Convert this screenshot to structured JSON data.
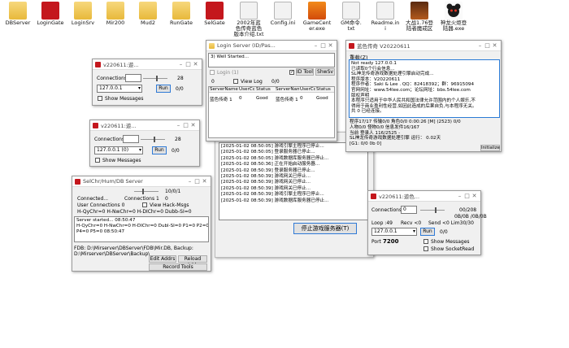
{
  "desktop": {
    "icons": [
      {
        "label": "DBServer",
        "type": "folder"
      },
      {
        "label": "LoginGate",
        "type": "exe-red"
      },
      {
        "label": "LoginSrv",
        "type": "folder"
      },
      {
        "label": "Mir200",
        "type": "folder"
      },
      {
        "label": "Mud2",
        "type": "folder"
      },
      {
        "label": "RunGate",
        "type": "folder"
      },
      {
        "label": "SelGate",
        "type": "exe-red"
      },
      {
        "label": "2002年蓝\n色传奇蓝色\n版本介绍.txt",
        "type": "doc"
      },
      {
        "label": "Config.ini",
        "type": "doc"
      },
      {
        "label": "GameCent\ner.exe",
        "type": "exe-orange"
      },
      {
        "label": "GM命令.\ntxt",
        "type": "doc"
      },
      {
        "label": "Readme.in\ni",
        "type": "doc"
      },
      {
        "label": "大战1.76登\n陆者魔戒区",
        "type": "game"
      },
      {
        "label": "神龙火炬登\n陆器.exe",
        "type": "bear"
      }
    ]
  },
  "login_gate": {
    "title": "v220611:遊...",
    "connections_label": "Connections",
    "count": "28",
    "ip": "127.0.0.1",
    "ratio": "0/0",
    "run_label": "Run",
    "show_messages_label": "Show Messages"
  },
  "sel_gate": {
    "title": "v220611:遊...",
    "connections_label": "Connections",
    "count": "28",
    "ip": "127.0.0.1 (0)",
    "ratio": "0/0",
    "run_label": "Run",
    "show_messages_label": "Show Messages"
  },
  "login_server": {
    "title": "Login Server (ID/Pas...",
    "status_line": "3) Well Started...",
    "login_label": "Login (1)",
    "login_count": "0",
    "view_log_label": "View Log",
    "view_log_value": "0/0",
    "id_tool_label": "ID Tool",
    "show_sv_label": "ShwSv",
    "columns": [
      "ServerName",
      "UserCc",
      "Status",
      "ServerName",
      "UserCc",
      "Status"
    ],
    "rows": [
      [
        "蓝色传奇 1",
        "0",
        "Good",
        "蓝色传奇 1",
        "0",
        "Good"
      ]
    ]
  },
  "game_center": {
    "log_lines": [
      "[2025-01-02 08:50:05] 游戏引擎主程序已停止...",
      "[2025-01-02 08:50:05] 登录服务器已停止...",
      "[2025-01-02 08:50:05] 游戏数据库服务器已停止...",
      "[2025-01-02 08:50:36] 正在开始启动服务器...",
      "[2025-01-02 08:50:39] 登录服务器已停止...",
      "[2025-01-02 08:50:39] 游戏网关已停止...",
      "[2025-01-02 08:50:39] 游戏网关已停止...",
      "[2025-01-02 08:50:39] 游戏网关已停止...",
      "[2025-01-02 08:50:39] 游戏引擎主程序已停止...",
      "[2025-01-02 08:50:39] 游戏数据库服务器已停止..."
    ],
    "stop_button_label": "停止游戏服务器(T)"
  },
  "m2_server": {
    "title": "蓝色传奇   V20220611",
    "menu_label": "重载(Z)",
    "messages": [
      "Not ready 127.0.0.1",
      "已读取0个行会信息...",
      "SL神龙传奇游戏数据处理引擎启动完成...",
      "程序版本：V20220611",
      "程序作者：Saki & Lee . QQ：82418392；群：96915094",
      "官网网址：www.54lee.com；论坛网址：bbs.54lee.com",
      "版权声明",
      "本程序只适用于中华人民共和国法律允许范围内的个人娱乐,不",
      "得用于商业盈利性经营,如因此造成的后果自负,与本程序无关。",
      "共 0 已经连接。"
    ],
    "stat_lines": [
      "程序17/17 传输0/0 角色0/0   0:00:26 [M]   (2523)  0/0",
      "人物0/0 怪物0/0 信息发件16/167",
      "当前 登录人 116/2525 -",
      "SL神龙传奇游戏数据处理引擎         运行：  0.02天",
      "[G1: 0/0 0b 0]"
    ],
    "init_button_label": "Initialize"
  },
  "db_server": {
    "title": "SelChr/Hum/DB Server",
    "count": "10/0/1",
    "connected_label": "Connected...",
    "connections_label": "Connections 1",
    "connections_value": "0",
    "user_connections_label": "User Connections 0",
    "view_hack_label": "View Hack-Msgs",
    "stats_line": "H-QyChr=0  H-NwChr=0  H-DIChr=0    Dubb-SI=0",
    "log_lines": [
      "Server started... 08:50:47",
      "H-QyChr=0 H-NwChr=0 H-DIChr=0 Dubl-SI=0 P1=0 P2=0 P3=0",
      "P4=0 P5=0 08:50:47"
    ],
    "fdb_line": "FDB: D:\\Mirserver\\DBServer\\FDB\\Mir.DB, Backup:",
    "backup_line": "D:\\Mirserver\\DBServer\\Backup\\",
    "edit_addrs_label": "Edit Addrs",
    "reload_addr_label": "Reload Addr",
    "record_tools_label": "Record Tools"
  },
  "run_gate": {
    "title": "v220611:遊色...",
    "connections_label": "Connections",
    "connections_value": "0",
    "ratio": "00/208",
    "loop_label": "Loop :49",
    "recv_label": "Recv <0",
    "send_label": "Send <0 Lim30/30",
    "ip": "127.0.0.1",
    "run_label": "Run",
    "run_value": "0/0",
    "port_label": "Port",
    "port_value": "7200",
    "show_messages_label": "Show Messages",
    "show_socket_label": "Show SocketRead",
    "speed": "0B/0B /0B/0B"
  }
}
